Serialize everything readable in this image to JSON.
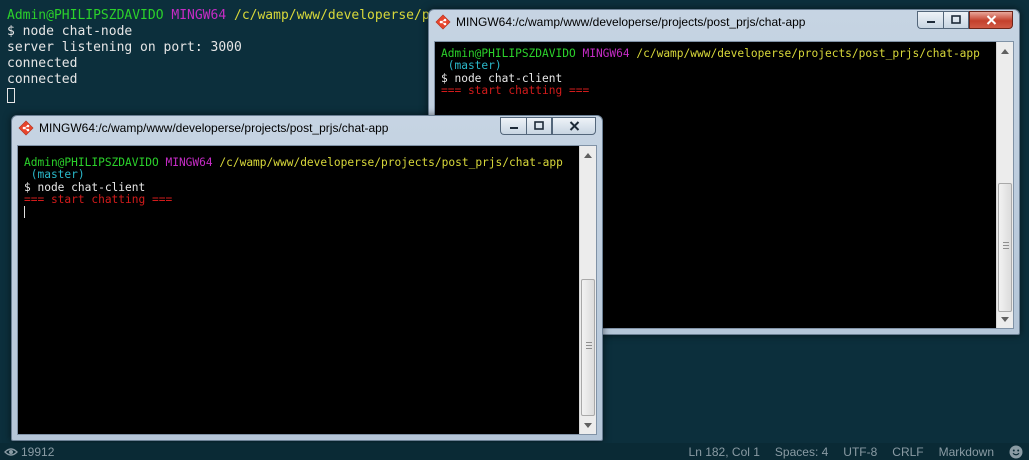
{
  "background_terminal": {
    "prompt_user": "Admin@PHILIPSZDAVIDO",
    "prompt_env": "MINGW64",
    "prompt_path": "/c/wamp/www/developerse/proje",
    "lines": [
      "$ node chat-node",
      "server listening on port: 3000",
      "connected",
      "connected"
    ]
  },
  "window_right": {
    "title": "MINGW64:/c/wamp/www/developerse/projects/post_prjs/chat-app",
    "prompt_user": "Admin@PHILIPSZDAVIDO",
    "prompt_env": "MINGW64",
    "prompt_path": "/c/wamp/www/developerse/projects/post_prjs/chat-app",
    "branch": " (master)",
    "command": "$ node chat-client",
    "output": "=== start chatting ==="
  },
  "window_left": {
    "title": "MINGW64:/c/wamp/www/developerse/projects/post_prjs/chat-app",
    "prompt_user": "Admin@PHILIPSZDAVIDO",
    "prompt_env": "MINGW64",
    "prompt_path": "/c/wamp/www/developerse/projects/post_prjs/chat-app",
    "branch": " (master)",
    "command": "$ node chat-client",
    "output": "=== start chatting ==="
  },
  "statusbar": {
    "views": "19912",
    "position": "Ln 182, Col 1",
    "spaces": "Spaces: 4",
    "encoding": "UTF-8",
    "line_ending": "CRLF",
    "language": "Markdown"
  },
  "colors": {
    "prompt_user": "#2bd12b",
    "prompt_env": "#c52cc5",
    "prompt_path": "#d8d83a",
    "branch": "#2ab7c9",
    "chat_banner": "#d21b1b"
  }
}
